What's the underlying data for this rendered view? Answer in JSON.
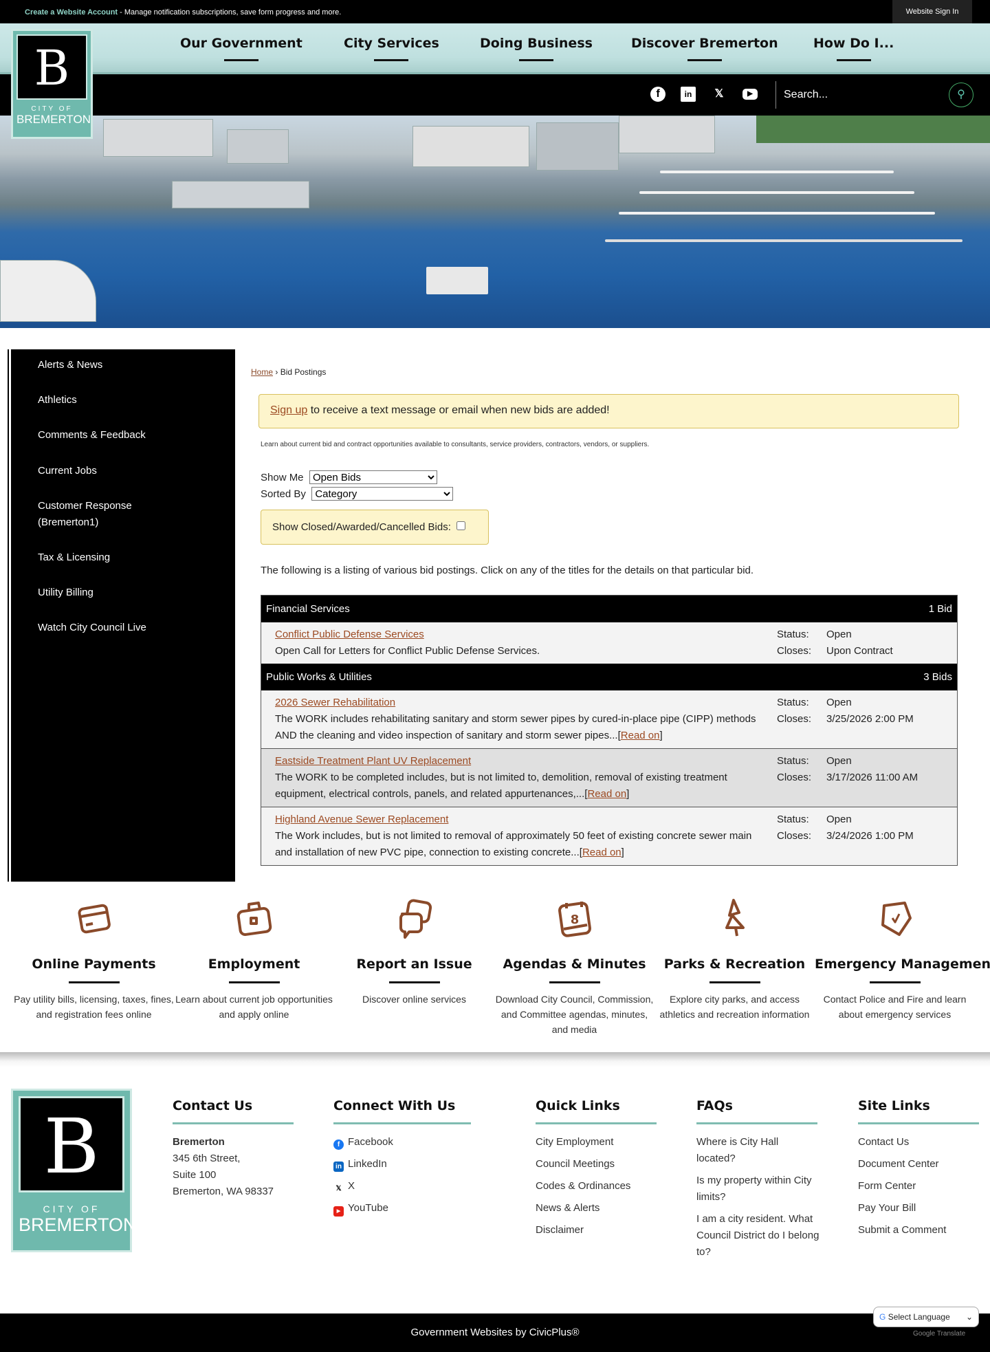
{
  "topbar": {
    "create_account": "Create a Website Account",
    "create_account_desc": " - Manage notification subscriptions, save form progress and more.",
    "sign_in": "Website Sign In"
  },
  "logo": {
    "letter": "B",
    "city": "CITY OF",
    "name": "BREMERTON"
  },
  "nav": [
    "Our Government",
    "City Services",
    "Doing Business",
    "Discover Bremerton",
    "How Do I..."
  ],
  "social": [
    "facebook-icon",
    "linkedin-icon",
    "x-icon",
    "youtube-icon"
  ],
  "search": {
    "placeholder": "Search..."
  },
  "sidebar": [
    "Alerts & News",
    "Athletics",
    "Comments & Feedback",
    "Current Jobs",
    "Customer Response (Bremerton1)",
    "Tax & Licensing",
    "Utility Billing",
    "Watch City Council Live"
  ],
  "breadcrumb": {
    "home": "Home",
    "sep": " › ",
    "current": "Bid Postings"
  },
  "signup": {
    "link": "Sign up",
    "text": " to receive a text message or email when new bids are added!"
  },
  "learn": "Learn about current bid and contract opportunities available to consultants, service providers, contractors, vendors, or suppliers.",
  "filters": {
    "show_me_label": "Show Me",
    "show_me_value": "Open Bids",
    "sorted_by_label": "Sorted By",
    "sorted_by_value": "Category",
    "closed_label": "Show Closed/Awarded/Cancelled Bids:"
  },
  "listing": "The following is a listing of various bid postings. Click on any of the titles for the details on that particular bid.",
  "status_label": "Status:",
  "closes_label": "Closes:",
  "read_on": "Read on",
  "categories": [
    {
      "name": "Financial Services",
      "count": "1 Bid",
      "bids": [
        {
          "title": "Conflict Public Defense Services",
          "desc": "Open Call for Letters for Conflict Public Defense Services.",
          "status": "Open",
          "closes": "Upon Contract"
        }
      ]
    },
    {
      "name": "Public Works & Utilities",
      "count": "3 Bids",
      "bids": [
        {
          "title": "2026 Sewer Rehabilitation",
          "desc": "The WORK includes rehabilitating sanitary and storm sewer pipes by cured-in-place pipe (CIPP) methods AND the cleaning and video inspection of sanitary and storm sewer pipes...",
          "status": "Open",
          "closes": "3/25/2026 2:00 PM"
        },
        {
          "title": "Eastside Treatment Plant UV Replacement",
          "desc": "The WORK to be completed includes, but is not limited to, demolition, removal of existing treatment equipment, electrical controls, panels, and related appurtenances,...",
          "status": "Open",
          "closes": "3/17/2026 11:00 AM"
        },
        {
          "title": "Highland Avenue Sewer Replacement",
          "desc": "The Work includes, but is not limited to removal of approximately 50 feet of existing concrete sewer main and installation of new PVC pipe, connection to existing concrete...",
          "status": "Open",
          "closes": "3/24/2026 1:00 PM"
        }
      ]
    }
  ],
  "features": [
    {
      "title": "Online Payments",
      "desc": "Pay utility bills, licensing, taxes, fines, and registration fees online",
      "icon": "credit-card-icon"
    },
    {
      "title": "Employment",
      "desc": "Learn about current job opportunities and apply online",
      "icon": "briefcase-icon"
    },
    {
      "title": "Report an Issue",
      "desc": "Discover online services",
      "icon": "chat-bubbles-icon"
    },
    {
      "title": "Agendas & Minutes",
      "desc": "Download City Council, Commission, and Committee agendas, minutes, and media",
      "icon": "calendar-icon"
    },
    {
      "title": "Parks & Recreation",
      "desc": "Explore city parks, and access athletics and recreation information",
      "icon": "tree-icon"
    },
    {
      "title": "Emergency Management",
      "desc": "Contact Police and Fire and learn about emergency services",
      "icon": "shield-check-icon"
    }
  ],
  "footer": {
    "contact": {
      "title": "Contact Us",
      "name": "Bremerton",
      "lines": [
        "345 6th Street,",
        "Suite 100",
        "Bremerton, WA 98337"
      ]
    },
    "connect": {
      "title": "Connect With Us",
      "items": [
        "Facebook",
        "LinkedIn",
        "X",
        "YouTube"
      ]
    },
    "quick": {
      "title": "Quick Links",
      "items": [
        "City Employment",
        "Council Meetings",
        "Codes & Ordinances",
        "News & Alerts",
        "Disclaimer"
      ]
    },
    "faqs": {
      "title": "FAQs",
      "items": [
        "Where is City Hall located?",
        "Is my property within City limits?",
        "I am a city resident. What Council District do I belong to?"
      ]
    },
    "site": {
      "title": "Site Links",
      "items": [
        "Contact Us",
        "Document Center",
        "Form Center",
        "Pay Your Bill",
        "Submit a Comment"
      ]
    }
  },
  "bottom": {
    "credit": "Government Websites by CivicPlus®",
    "language": "Select Language",
    "translate": "Google Translate"
  },
  "colors": {
    "accent": "#9c4a22",
    "teal": "#6fb9ad",
    "notice_bg": "#fdf5cc"
  }
}
